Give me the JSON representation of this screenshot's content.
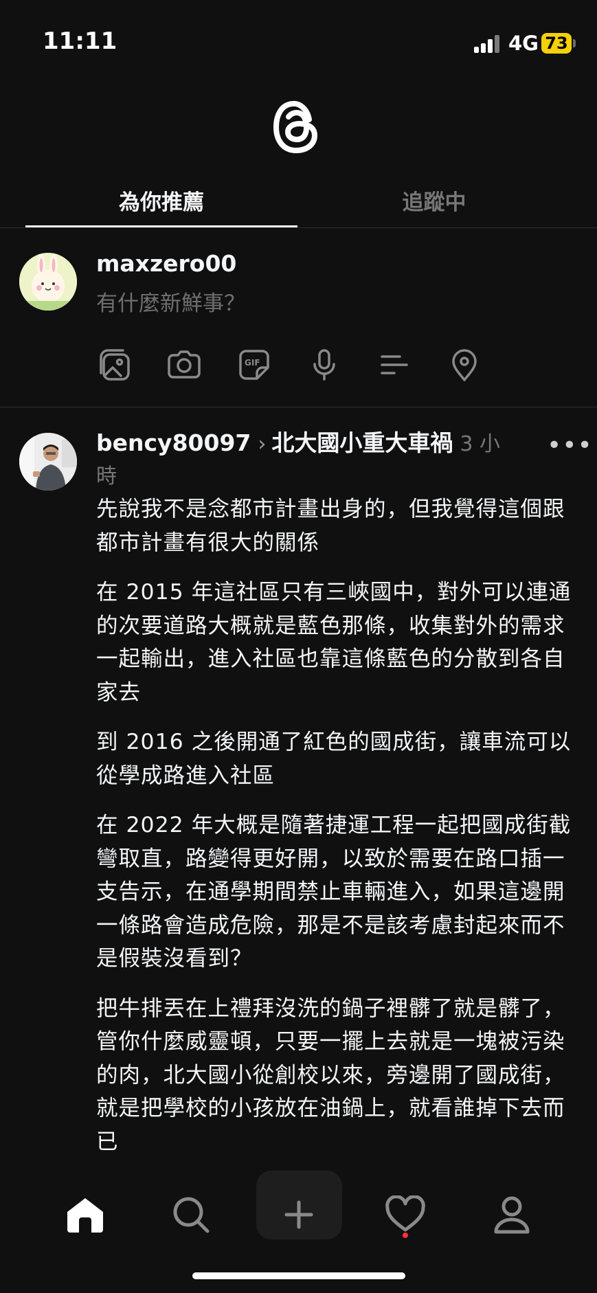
{
  "status_bar": {
    "time": "11:11",
    "network": "4G",
    "battery": "73"
  },
  "tabs": [
    {
      "label": "為你推薦",
      "active": true
    },
    {
      "label": "追蹤中",
      "active": false
    }
  ],
  "composer": {
    "username": "maxzero00",
    "placeholder": "有什麼新鮮事？",
    "tools": [
      "gallery-icon",
      "camera-icon",
      "gif-icon",
      "microphone-icon",
      "poll-icon",
      "location-icon"
    ]
  },
  "post": {
    "username": "bency80097",
    "topic": "北大國小重大車禍",
    "time": "3 小時",
    "paragraphs": [
      "先說我不是念都市計畫出身的，但我覺得這個跟都市計畫有很大的關係",
      "在 2015 年這社區只有三峽國中，對外可以連通的次要道路大概就是藍色那條，收集對外的需求一起輸出，進入社區也靠這條藍色的分散到各自家去",
      "到 2016 之後開通了紅色的國成街，讓車流可以從學成路進入社區",
      "在 2022 年大概是隨著捷運工程一起把國成街截彎取直，路變得更好開，以致於需要在路口插一支告示，在通學期間禁止車輛進入，如果這邊開一條路會造成危險，那是不是該考慮封起來而不是假裝沒看到？",
      "把牛排丟在上禮拜沒洗的鍋子裡髒了就是髒了，管你什麼威靈頓，只要一擺上去就是一塊被污染的肉，北大國小從創校以來，旁邊開了國成街，就是把學校的小孩放在油鍋上，就看誰掉下去而已"
    ]
  },
  "nav": [
    "home-icon",
    "search-icon",
    "compose-icon",
    "activity-icon",
    "profile-icon"
  ],
  "colors": {
    "background": "#101010",
    "text": "#f3f5f7",
    "muted": "#777777",
    "battery": "#f5d00b",
    "notification": "#ff3040"
  }
}
